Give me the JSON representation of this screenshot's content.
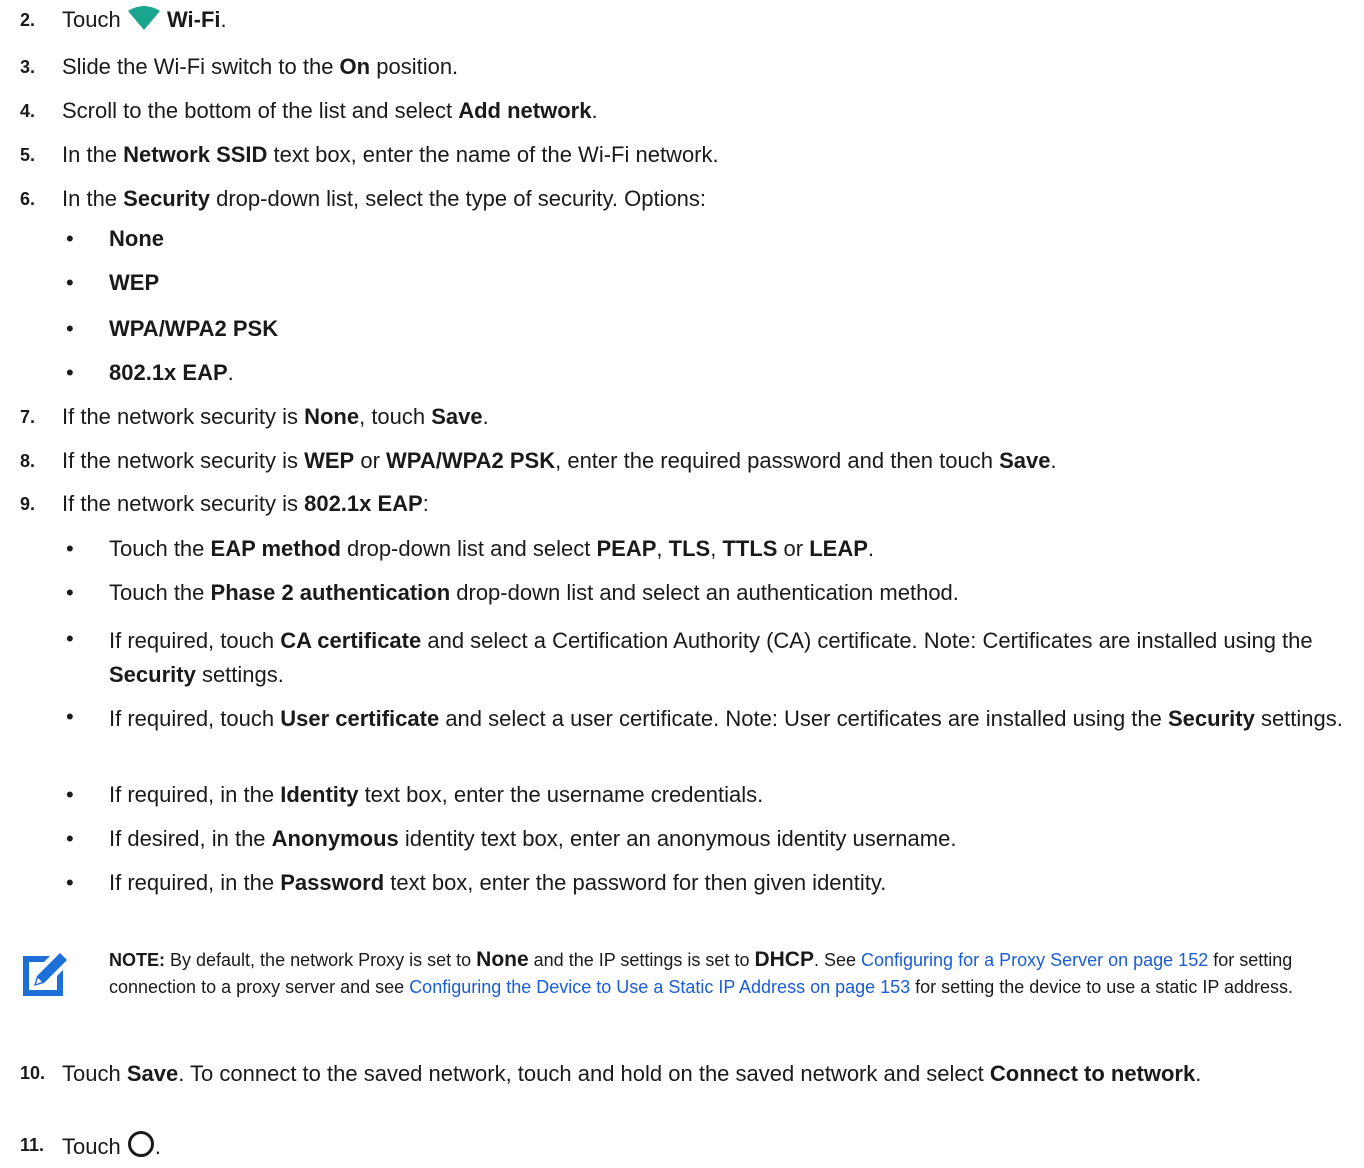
{
  "steps": {
    "s2": {
      "num": "2.",
      "a": "Touch ",
      "b": "Wi-Fi",
      "c": ".",
      "icon": "wifi-icon",
      "icon_color": "#1aa58e"
    },
    "s3": {
      "num": "3.",
      "a": "Slide the Wi-Fi switch to the ",
      "b": "On",
      "c": " position."
    },
    "s4": {
      "num": "4.",
      "a": "Scroll to the bottom of the list and select ",
      "b": "Add network",
      "c": "."
    },
    "s5": {
      "num": "5.",
      "a": "In the ",
      "b": "Network SSID",
      "c": " text box, enter the name of the Wi-Fi network."
    },
    "s6": {
      "num": "6.",
      "a": "In the ",
      "b": "Security",
      "c": " drop-down list, select the type of security. Options:"
    },
    "security_options": [
      "None",
      "WEP",
      "WPA/WPA2 PSK",
      "802.1x EAP"
    ],
    "option_suffix": ".",
    "s7": {
      "num": "7.",
      "a": "If the network security is ",
      "b": "None",
      "c": ", touch ",
      "d": "Save",
      "e": "."
    },
    "s8": {
      "num": "8.",
      "a": "If the network security is ",
      "b": "WEP",
      "c": " or ",
      "d": "WPA/WPA2 PSK",
      "e": ", enter the required password and then touch ",
      "f": "Save",
      "g": "."
    },
    "s9": {
      "num": "9.",
      "a": "If the network security is ",
      "b": "802.1x EAP",
      "c": ":"
    },
    "eap": {
      "e1": {
        "a": "Touch the ",
        "b": "EAP method",
        "c": " drop-down list and select ",
        "d": "PEAP",
        "e": ", ",
        "f": "TLS",
        "g": ", ",
        "h": "TTLS",
        "i": " or ",
        "j": "LEAP",
        "k": "."
      },
      "e2": {
        "a": "Touch the ",
        "b": "Phase 2 authentication",
        "c": " drop-down list and select an authentication method."
      },
      "e3": {
        "a": "If required, touch ",
        "b": "CA certificate",
        "c": " and select a Certification Authority (CA) certificate. Note: Certificates are installed using the ",
        "d": "Security",
        "e": " settings."
      },
      "e4": {
        "a": "If required, touch ",
        "b": "User certificate",
        "c": " and select a user certificate. Note: User certificates are installed using the ",
        "d": "Security",
        "e": " settings."
      },
      "e5": {
        "a": "If required, in the ",
        "b": "Identity",
        "c": " text box, enter the username credentials."
      },
      "e6": {
        "a": "If desired, in the ",
        "b": "Anonymous",
        "c": " identity text box, enter an anonymous identity username."
      },
      "e7": {
        "a": "If required, in the ",
        "b": "Password",
        "c": " text box, enter the password for then given identity."
      }
    },
    "s10": {
      "num": "10.",
      "a": "Touch ",
      "b": "Save",
      "c": ". To connect to the saved network, touch and hold on the saved network and select ",
      "d": "Connect to network",
      "e": "."
    },
    "s11": {
      "num": "11.",
      "a": "Touch ",
      "c": ".",
      "icon": "home-circle-icon"
    }
  },
  "note": {
    "label": "NOTE:",
    "t1": "   By default, the network Proxy is set to ",
    "b1": "None",
    "t2": " and the IP settings is set to ",
    "b2": "DHCP",
    "t3": ". See ",
    "link1": "Configuring for a Proxy Server on page 152",
    "t4": " for setting connection to a proxy server and see ",
    "link2": "Configuring the Device to Use a Static IP Address on page 153",
    "t5": " for setting the device to use a static IP address.",
    "icon": "note-pencil-icon",
    "icon_color": "#1e6fd8",
    "link_color": "#1a5dd6"
  }
}
